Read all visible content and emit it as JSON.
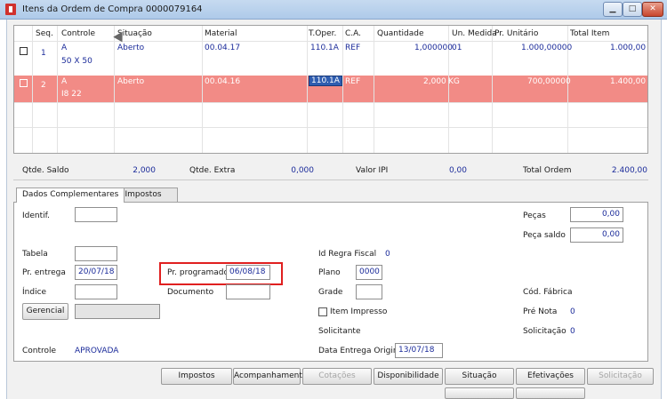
{
  "window": {
    "title": "Itens da Ordem de Compra 0000079164"
  },
  "grid": {
    "headers": {
      "seq": "Seq.",
      "controle": "Controle",
      "situacao": "Situação",
      "material": "Material",
      "toper": "T.Oper.",
      "ca": "C.A.",
      "quantidade": "Quantidade",
      "unmedida": "Un. Medida",
      "prunit": "Pr. Unitário",
      "total": "Total Item"
    },
    "rows": [
      {
        "seq": "1",
        "controle": "A",
        "controle2": "50 X 50",
        "situacao": "Aberto",
        "material": "00.04.17",
        "toper": "110.1A",
        "ca": "REF",
        "quantidade": "1,000000",
        "unmedida": "01",
        "prunit": "1.000,00000",
        "total": "1.000,00"
      },
      {
        "seq": "2",
        "controle": "A",
        "controle2": "I8 22",
        "situacao": "Aberto",
        "material": "00.04.16",
        "toper": "110.1A",
        "ca": "REF",
        "quantidade": "2,000",
        "unmedida": "KG",
        "prunit": "700,00000",
        "total": "1.400,00"
      }
    ]
  },
  "summary": {
    "saldo_label": "Qtde. Saldo",
    "saldo": "2,000",
    "extra_label": "Qtde. Extra",
    "extra": "0,000",
    "ipi_label": "Valor IPI",
    "ipi": "0,00",
    "total_label": "Total Ordem",
    "total": "2.400,00"
  },
  "tabs": {
    "dados": "Dados Complementares",
    "impostos": "Impostos"
  },
  "form": {
    "identif_label": "Identif.",
    "tabela_label": "Tabela",
    "pr_entrega_label": "Pr. entrega",
    "pr_entrega": "20/07/18",
    "indice_label": "Índice",
    "gerencial_label": "Gerencial",
    "pr_programado_label": "Pr. programado",
    "pr_programado": "06/08/18",
    "documento_label": "Documento",
    "controle_label": "Controle",
    "controle": "APROVADA",
    "id_regra_label": "Id Regra Fiscal",
    "id_regra": "0",
    "plano_label": "Plano",
    "plano": "0000",
    "grade_label": "Grade",
    "item_impresso_label": "Item Impresso",
    "solicitante_label": "Solicitante",
    "data_entrega_label": "Data Entrega Original",
    "data_entrega": "13/07/18",
    "pecas_label": "Peças",
    "pecas": "0,00",
    "peca_saldo_label": "Peça saldo",
    "peca_saldo": "0,00",
    "cod_fabrica_label": "Cód. Fábrica",
    "pre_nota_label": "Pré Nota",
    "pre_nota": "0",
    "solicitacao_label": "Solicitação",
    "solicitacao": "0"
  },
  "buttons": {
    "impostos": "Impostos",
    "acompanhamento": "Acompanhamento",
    "cotacoes": "Cotações",
    "disponibilidade": "Disponibilidade",
    "situacao": "Situação",
    "efetivacoes": "Efetivações",
    "solicitacao": "Solicitação"
  }
}
